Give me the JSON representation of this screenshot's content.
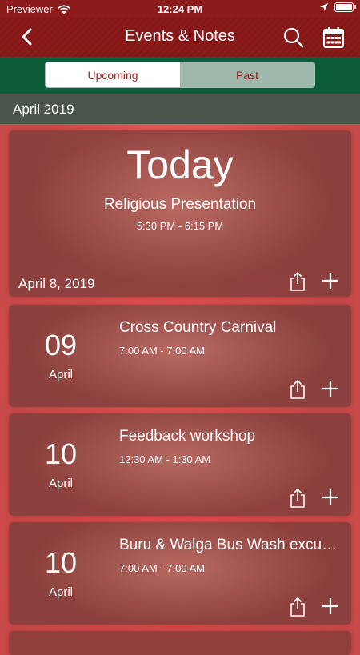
{
  "status_bar": {
    "carrier": "Previewer",
    "time": "12:24 PM"
  },
  "nav": {
    "title": "Events & Notes",
    "back_icon": "chevron-left-icon",
    "search_icon": "search-icon",
    "calendar_icon": "calendar-icon"
  },
  "segments": {
    "upcoming": "Upcoming",
    "past": "Past",
    "selected": "Upcoming"
  },
  "month_header": "April 2019",
  "today_card": {
    "heading": "Today",
    "title": "Religious Presentation",
    "time": "5:30 PM - 6:15 PM",
    "date": "April 8, 2019"
  },
  "events": [
    {
      "day": "09",
      "month": "April",
      "title": "Cross Country Carnival",
      "time": "7:00 AM - 7:00 AM"
    },
    {
      "day": "10",
      "month": "April",
      "title": "Feedback workshop",
      "time": "12:30 AM - 1:30 AM"
    },
    {
      "day": "10",
      "month": "April",
      "title": "Buru & Walga Bus Wash excursion",
      "time": "7:00 AM - 7:00 AM"
    }
  ],
  "colors": {
    "nav_red": "#8b1a1a",
    "segment_green": "#0c5c38",
    "accent_red": "#a01f1f"
  }
}
